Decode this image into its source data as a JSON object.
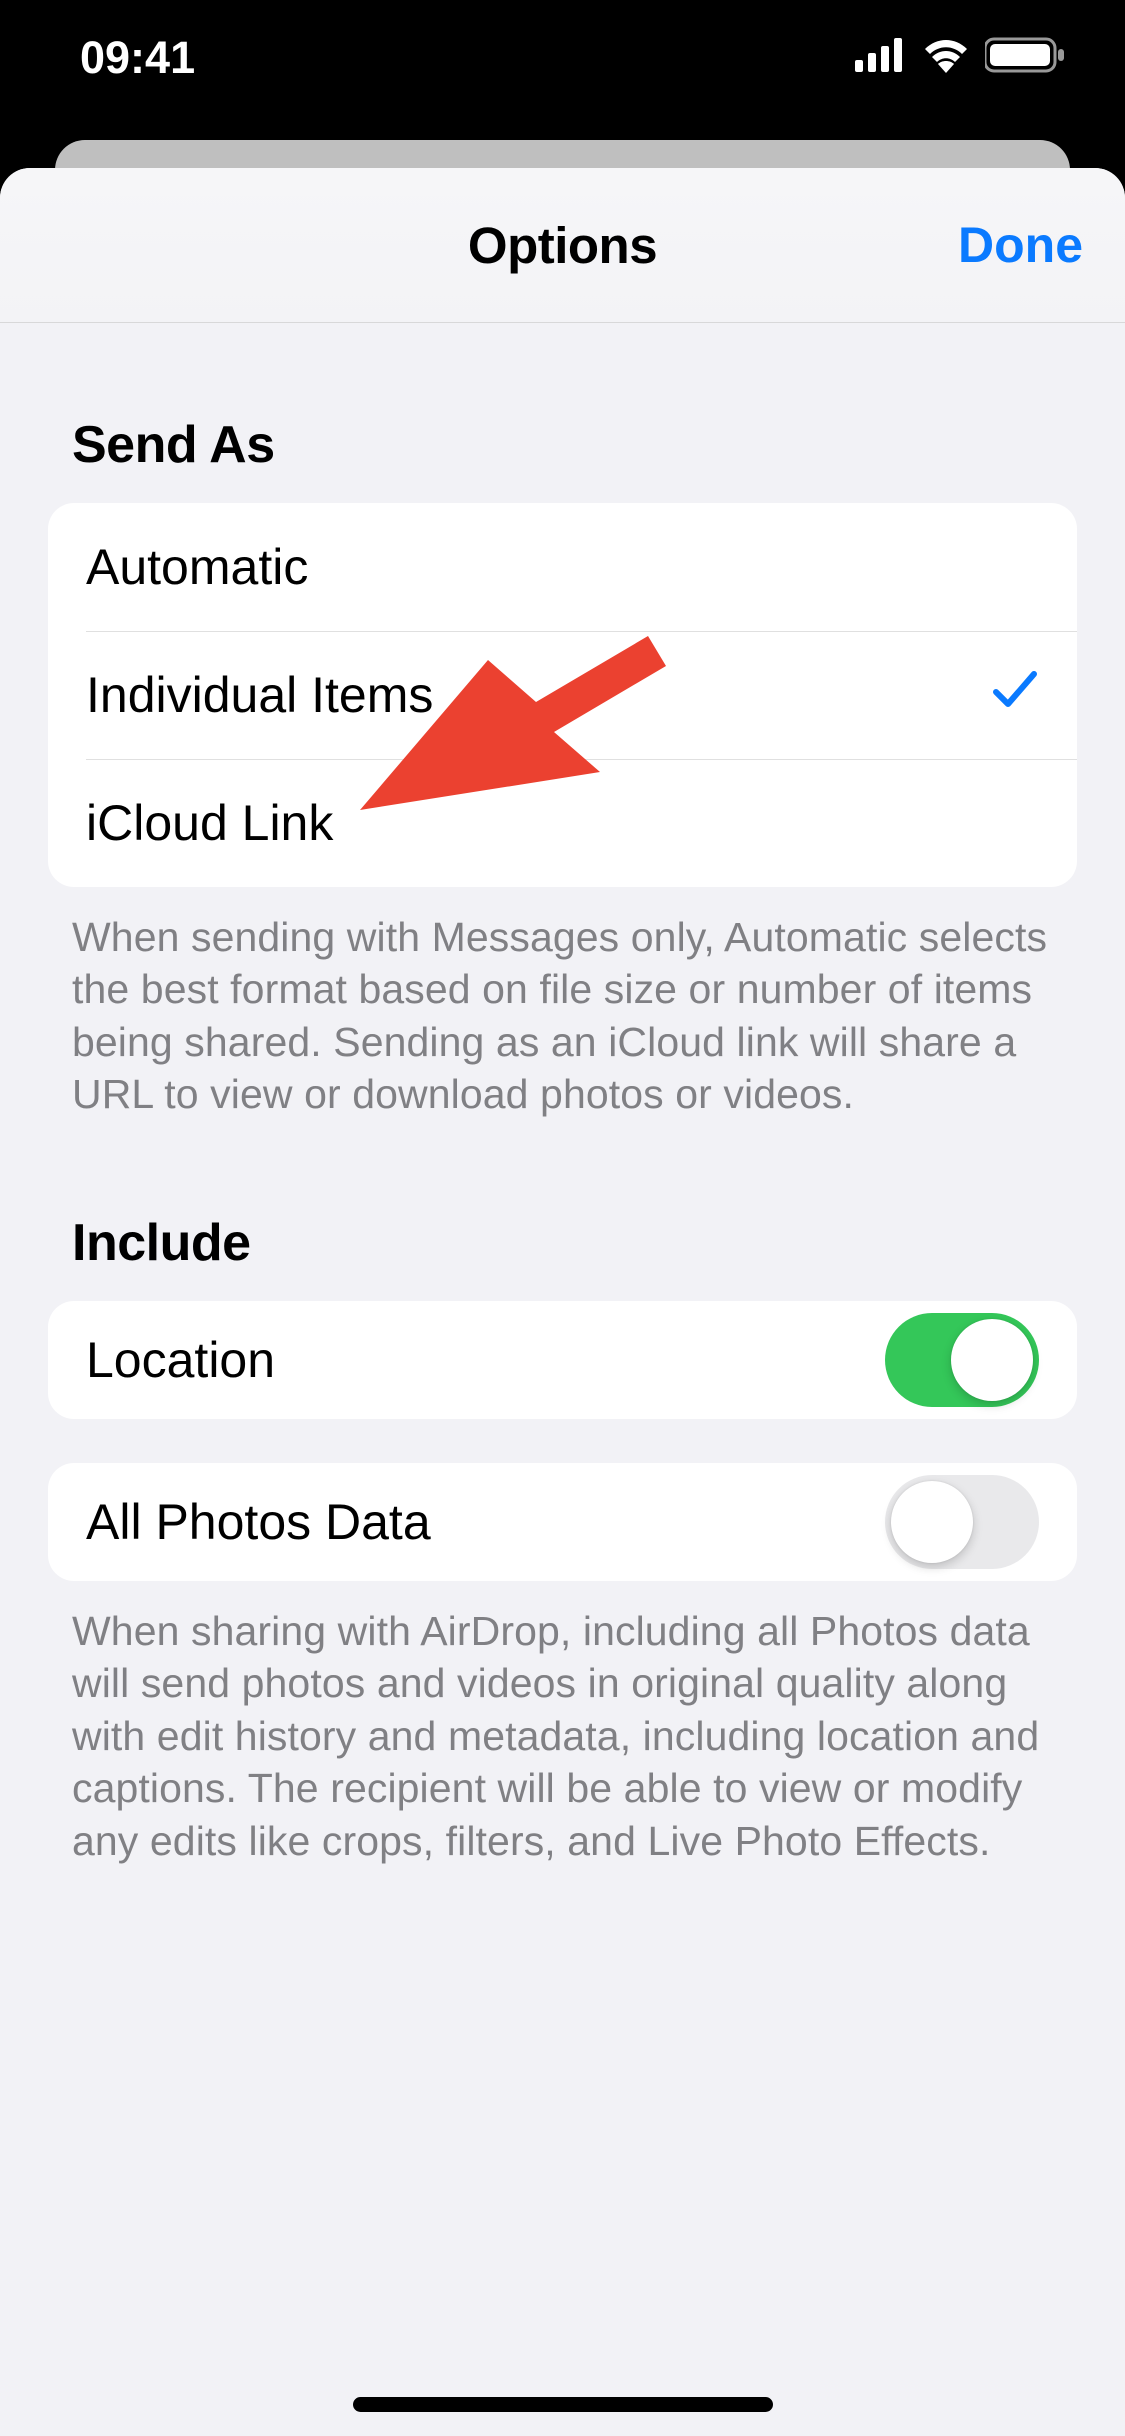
{
  "status": {
    "time": "09:41"
  },
  "nav": {
    "title": "Options",
    "done_label": "Done"
  },
  "sections": {
    "send_as": {
      "header": "Send As",
      "options": [
        {
          "label": "Automatic",
          "selected": false
        },
        {
          "label": "Individual Items",
          "selected": true
        },
        {
          "label": "iCloud Link",
          "selected": false
        }
      ],
      "footer": "When sending with Messages only, Automatic selects the best format based on file size or number of items being shared. Sending as an iCloud link will share a URL to view or download photos or videos."
    },
    "include": {
      "header": "Include",
      "location": {
        "label": "Location",
        "enabled": true
      },
      "all_photos_data": {
        "label": "All Photos Data",
        "enabled": false
      },
      "footer": "When sharing with AirDrop, including all Photos data will send photos and videos in original quality along with edit history and metadata, including location and captions. The recipient will be able to view or modify any edits like crops, filters, and Live Photo Effects."
    }
  },
  "colors": {
    "accent": "#0a7aff",
    "toggle_on": "#34c759",
    "arrow": "#eb4130"
  }
}
